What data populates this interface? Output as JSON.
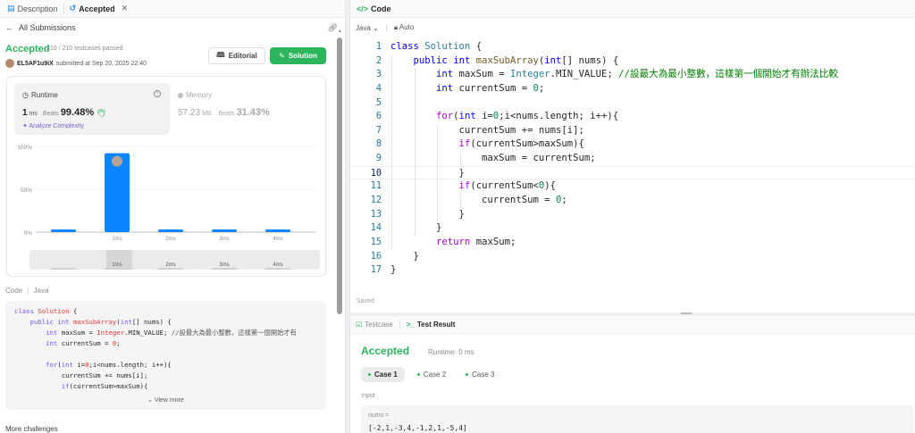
{
  "left": {
    "tabs": [
      {
        "label": "Description",
        "icon": "document-icon"
      },
      {
        "label": "Accepted",
        "icon": "history-icon",
        "close": "✕"
      }
    ],
    "back_label": "All Submissions",
    "status": "Accepted",
    "passed": "210 / 210 testcases passed",
    "user": "EL5AF1u9iX",
    "submitted": "submitted at Sep 20, 2025 22:40",
    "editorial_label": "Editorial",
    "solution_label": "Solution",
    "runtime": {
      "label": "Runtime",
      "value": "1",
      "unit": "ms",
      "beats_label": "Beats",
      "beats": "99.48%",
      "analyze": "Analyze Complexity"
    },
    "memory": {
      "label": "Memory",
      "value": "57.23",
      "unit": "MB",
      "beats_label": "Beats",
      "beats": "31.43%"
    },
    "code_label": "Code",
    "code_sep": "|",
    "code_lang": "Java",
    "view_more": "View more",
    "more_challenges": "More challenges"
  },
  "chart_data": {
    "type": "bar",
    "y_ticks": [
      "100%",
      "50%",
      "0%"
    ],
    "ylim": [
      0,
      100
    ],
    "categories": [
      "",
      "1ms",
      "2ms",
      "3ms",
      "4ms"
    ],
    "values": [
      3,
      92,
      3,
      3,
      3
    ],
    "highlight_index": 1,
    "colors": {
      "bar": "#0a84ff",
      "axis": "#bfbfbf"
    },
    "range_labels": [
      "",
      "1ms",
      "2ms",
      "3ms",
      "4ms"
    ]
  },
  "editor": {
    "title": "Code",
    "language": "Java",
    "indent": "Auto",
    "saved": "Saved",
    "current_line": 10
  },
  "result": {
    "tabs": [
      "Testcase",
      "Test Result"
    ],
    "status": "Accepted",
    "runtime": "Runtime: 0 ms",
    "cases": [
      "Case 1",
      "Case 2",
      "Case 3"
    ],
    "active_case": 0,
    "input_label": "Input",
    "input_name": "nums =",
    "input_value": "[-2,1,-3,4,-1,2,1,-5,4]"
  }
}
